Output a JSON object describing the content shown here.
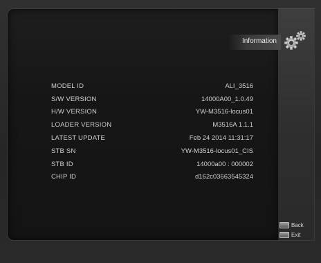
{
  "header": {
    "title": "Information"
  },
  "info_rows": [
    {
      "label": "MODEL ID",
      "value": "ALI_3516"
    },
    {
      "label": "S/W VERSION",
      "value": "14000A00_1.0.49"
    },
    {
      "label": "H/W VERSION",
      "value": "YW-M3516-locus01"
    },
    {
      "label": "LOADER VERSION",
      "value": "M3516A 1.1.1"
    },
    {
      "label": "LATEST UPDATE",
      "value": "Feb 24 2014 11:31:17"
    },
    {
      "label": "STB SN",
      "value": "YW-M3516-locus01_CIS"
    },
    {
      "label": "STB ID",
      "value": "14000a00 : 000002"
    },
    {
      "label": "CHIP ID",
      "value": "d162c03663545324"
    }
  ],
  "hints": [
    {
      "key_icon": "back-key-icon",
      "label": "Back"
    },
    {
      "key_icon": "exit-key-icon",
      "label": "Exit"
    }
  ],
  "icons": {
    "header_icon": "gears-icon"
  }
}
